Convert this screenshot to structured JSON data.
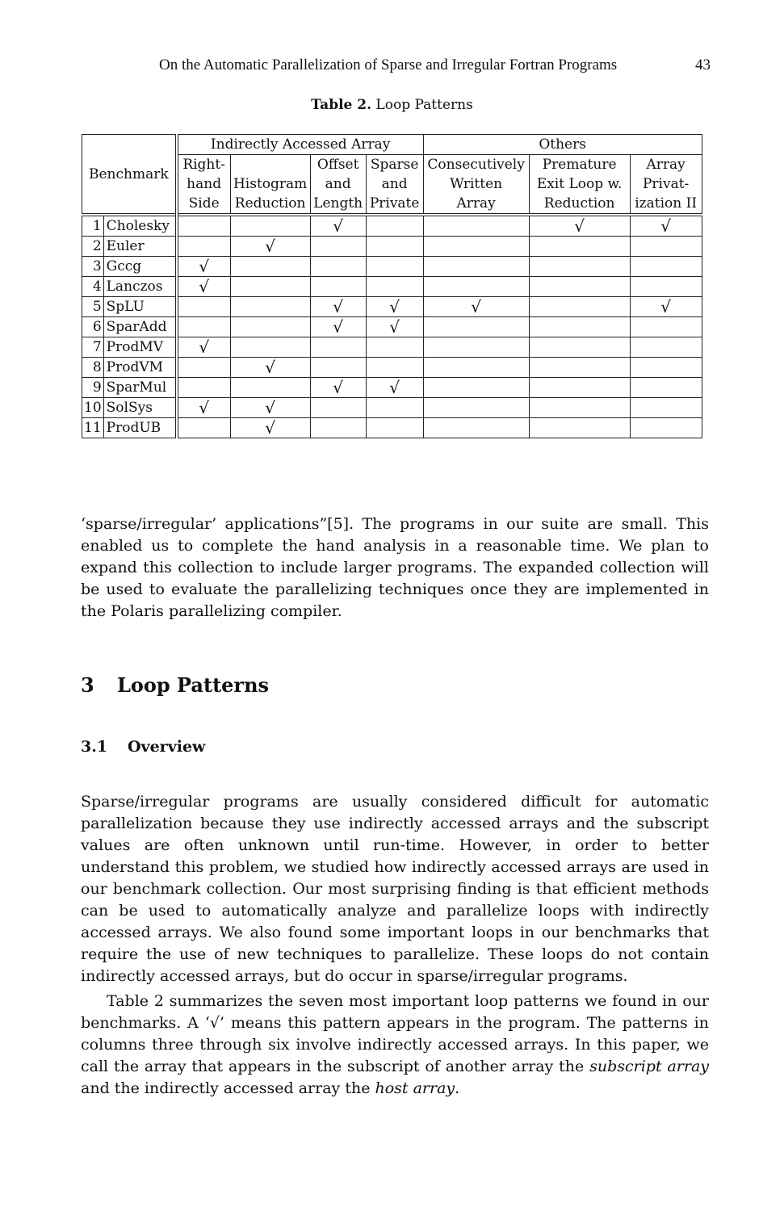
{
  "running_head": {
    "title": "On the Automatic Parallelization of Sparse and Irregular Fortran Programs",
    "page_number": "43"
  },
  "table": {
    "caption_label": "Table 2.",
    "caption_text": " Loop Patterns",
    "group_headers": {
      "benchmark": "Benchmark",
      "indirect": "Indirectly Accessed Array",
      "others": "Others"
    },
    "columns": [
      [
        "Right-",
        "hand",
        "Side"
      ],
      [
        "",
        "Histogram",
        "Reduction"
      ],
      [
        "Offset",
        "and",
        "Length"
      ],
      [
        "Sparse",
        "and",
        "Private"
      ],
      [
        "Consecutively",
        "Written",
        "Array"
      ],
      [
        "Premature",
        "Exit Loop w.",
        "Reduction"
      ],
      [
        "Array",
        "Privat-",
        "ization II"
      ]
    ],
    "check_symbol": "√",
    "rows": [
      {
        "num": "1",
        "name": "Cholesky",
        "marks": [
          false,
          false,
          true,
          false,
          false,
          true,
          true
        ]
      },
      {
        "num": "2",
        "name": "Euler",
        "marks": [
          false,
          true,
          false,
          false,
          false,
          false,
          false
        ]
      },
      {
        "num": "3",
        "name": "Gccg",
        "marks": [
          true,
          false,
          false,
          false,
          false,
          false,
          false
        ]
      },
      {
        "num": "4",
        "name": "Lanczos",
        "marks": [
          true,
          false,
          false,
          false,
          false,
          false,
          false
        ]
      },
      {
        "num": "5",
        "name": "SpLU",
        "marks": [
          false,
          false,
          true,
          true,
          true,
          false,
          true
        ]
      },
      {
        "num": "6",
        "name": "SparAdd",
        "marks": [
          false,
          false,
          true,
          true,
          false,
          false,
          false
        ]
      },
      {
        "num": "7",
        "name": "ProdMV",
        "marks": [
          true,
          false,
          false,
          false,
          false,
          false,
          false
        ]
      },
      {
        "num": "8",
        "name": "ProdVM",
        "marks": [
          false,
          true,
          false,
          false,
          false,
          false,
          false
        ]
      },
      {
        "num": "9",
        "name": "SparMul",
        "marks": [
          false,
          false,
          true,
          true,
          false,
          false,
          false
        ]
      },
      {
        "num": "10",
        "name": "SolSys",
        "marks": [
          true,
          true,
          false,
          false,
          false,
          false,
          false
        ]
      },
      {
        "num": "11",
        "name": "ProdUB",
        "marks": [
          false,
          true,
          false,
          false,
          false,
          false,
          false
        ]
      }
    ]
  },
  "paragraph_1": "‘sparse/irregular’ applications”[5]. The programs in our suite are small. This enabled us to complete the hand analysis in a reasonable time. We plan to expand this collection to include larger programs. The expanded collection will be used to evaluate the parallelizing techniques once they are implemented in the Polaris parallelizing compiler.",
  "section": {
    "number": "3",
    "title": "Loop Patterns"
  },
  "subsection": {
    "number": "3.1",
    "title": "Overview"
  },
  "paragraph_2": "Sparse/irregular programs are usually considered difficult for automatic parallelization because they use indirectly accessed arrays and the subscript values are often unknown until run-time. However, in order to better understand this problem, we studied how indirectly accessed arrays are used in our benchmark collection. Our most surprising finding is that efficient methods can be used to automatically analyze and parallelize loops with indirectly accessed arrays. We also found some important loops in our benchmarks that require the use of new techniques to parallelize. These loops do not contain indirectly accessed arrays, but do occur in sparse/irregular programs.",
  "paragraph_3": {
    "part1": "Table 2 summarizes the seven most important loop patterns we found in our benchmarks. A ‘√’ means this pattern appears in the program. The patterns in columns three through six involve indirectly accessed arrays. In this paper, we call the array that appears in the subscript of another array the ",
    "em1": "subscript array",
    "part2": " and the indirectly accessed array the ",
    "em2": "host array",
    "part3": "."
  }
}
